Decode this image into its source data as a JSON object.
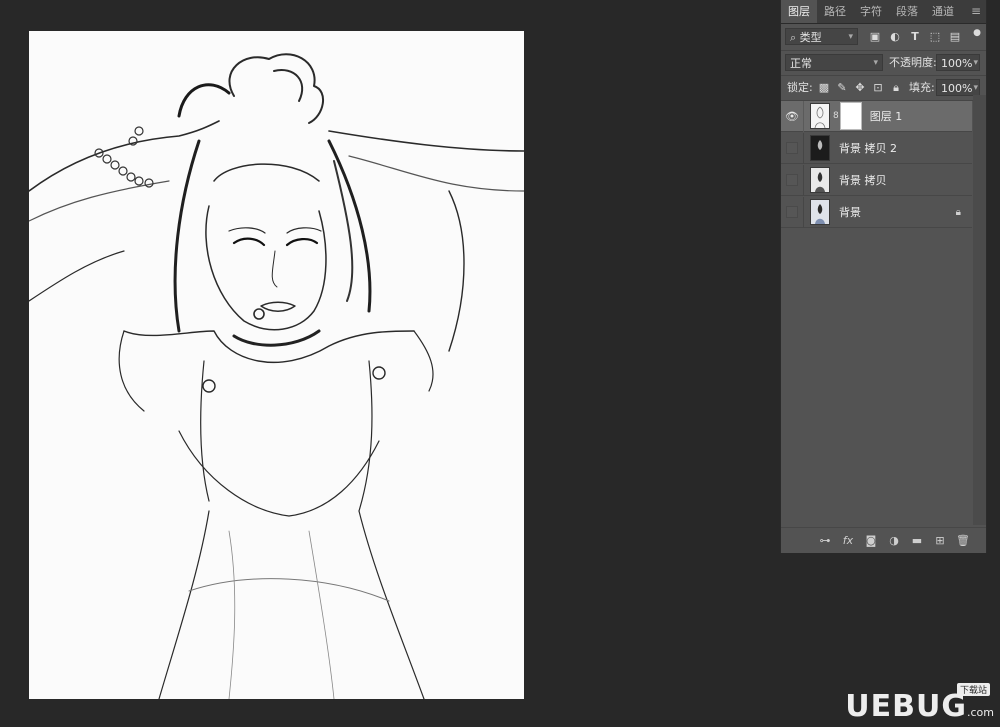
{
  "tabs": [
    "图层",
    "路径",
    "字符",
    "段落",
    "通道"
  ],
  "active_tab": "图层",
  "filter": {
    "kind_label": "类型"
  },
  "blend": {
    "mode": "正常",
    "opacity_label": "不透明度:",
    "opacity_value": "100%"
  },
  "lock": {
    "label": "锁定:",
    "fill_label": "填充:",
    "fill_value": "100%"
  },
  "layers": [
    {
      "name": "图层 1",
      "visible": true,
      "selected": true,
      "has_mask": true,
      "locked": false
    },
    {
      "name": "背景 拷贝 2",
      "visible": false,
      "selected": false,
      "has_mask": false,
      "locked": false
    },
    {
      "name": "背景 拷贝",
      "visible": false,
      "selected": false,
      "has_mask": false,
      "locked": false
    },
    {
      "name": "背景",
      "visible": false,
      "selected": false,
      "has_mask": false,
      "locked": true
    }
  ],
  "footer_icons": [
    "link-icon",
    "fx-icon",
    "mask-icon",
    "adjustment-icon",
    "folder-icon",
    "new-layer-icon",
    "trash-icon"
  ],
  "watermark": {
    "brand": "UEBUG",
    "suffix": ".com",
    "tag": "下载站"
  },
  "colors": {
    "app_bg": "#282828",
    "panel_bg": "#535353",
    "selected_layer": "#6b6b6b",
    "canvas_bg": "#fbfbfb"
  }
}
